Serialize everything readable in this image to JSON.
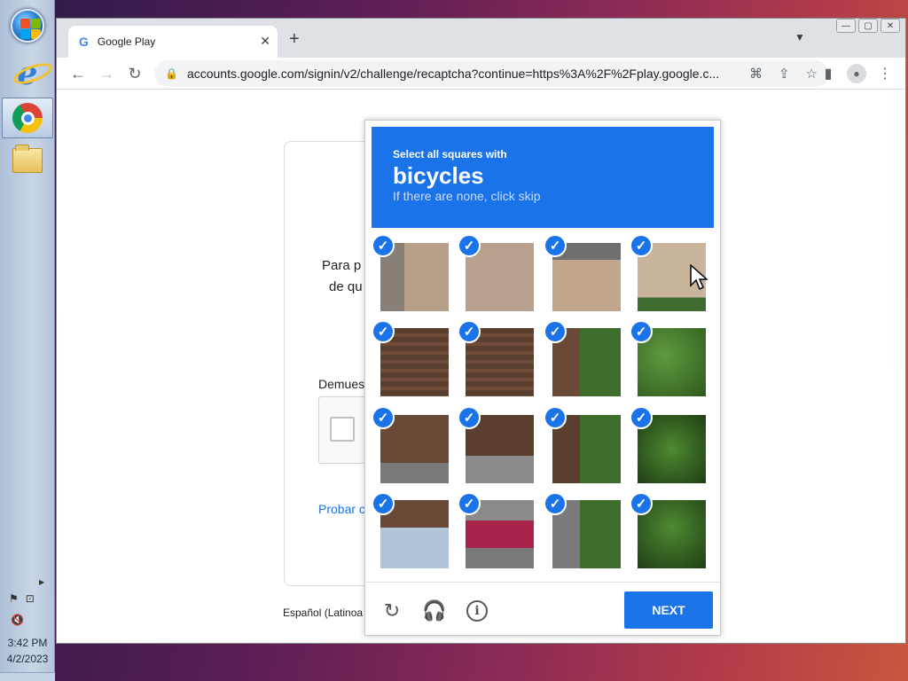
{
  "taskbar": {
    "clock_time": "3:42 PM",
    "clock_date": "4/2/2023",
    "icons": [
      "start-orb",
      "internet-explorer-icon",
      "chrome-icon",
      "file-explorer-icon"
    ]
  },
  "browser": {
    "tab_title": "Google Play",
    "tab_favicon": "G",
    "new_tab_symbol": "+",
    "close_symbol": "✕",
    "tab_list_symbol": "⌄",
    "url": "accounts.google.com/signin/v2/challenge/recaptcha?continue=https%3A%2F%2Fplay.google.c...",
    "colors": {
      "tabstrip": "#dee1e6",
      "accent": "#1a73e8"
    }
  },
  "page": {
    "line1": "Para p",
    "line2": "de qu",
    "prompt": "Demues",
    "link": "Probar c",
    "language": "Español (Latinoa"
  },
  "captcha": {
    "instruction": "Select all squares with",
    "target": "bicycles",
    "hint": "If there are none, click skip",
    "next_label": "NEXT",
    "grid_rows": 4,
    "grid_cols": 4,
    "selected_tiles": [
      true,
      true,
      true,
      true,
      true,
      true,
      true,
      true,
      true,
      true,
      true,
      true,
      true,
      true,
      true,
      true
    ],
    "footer_icons": [
      "reload-icon",
      "audio-headphones-icon",
      "info-icon"
    ]
  }
}
